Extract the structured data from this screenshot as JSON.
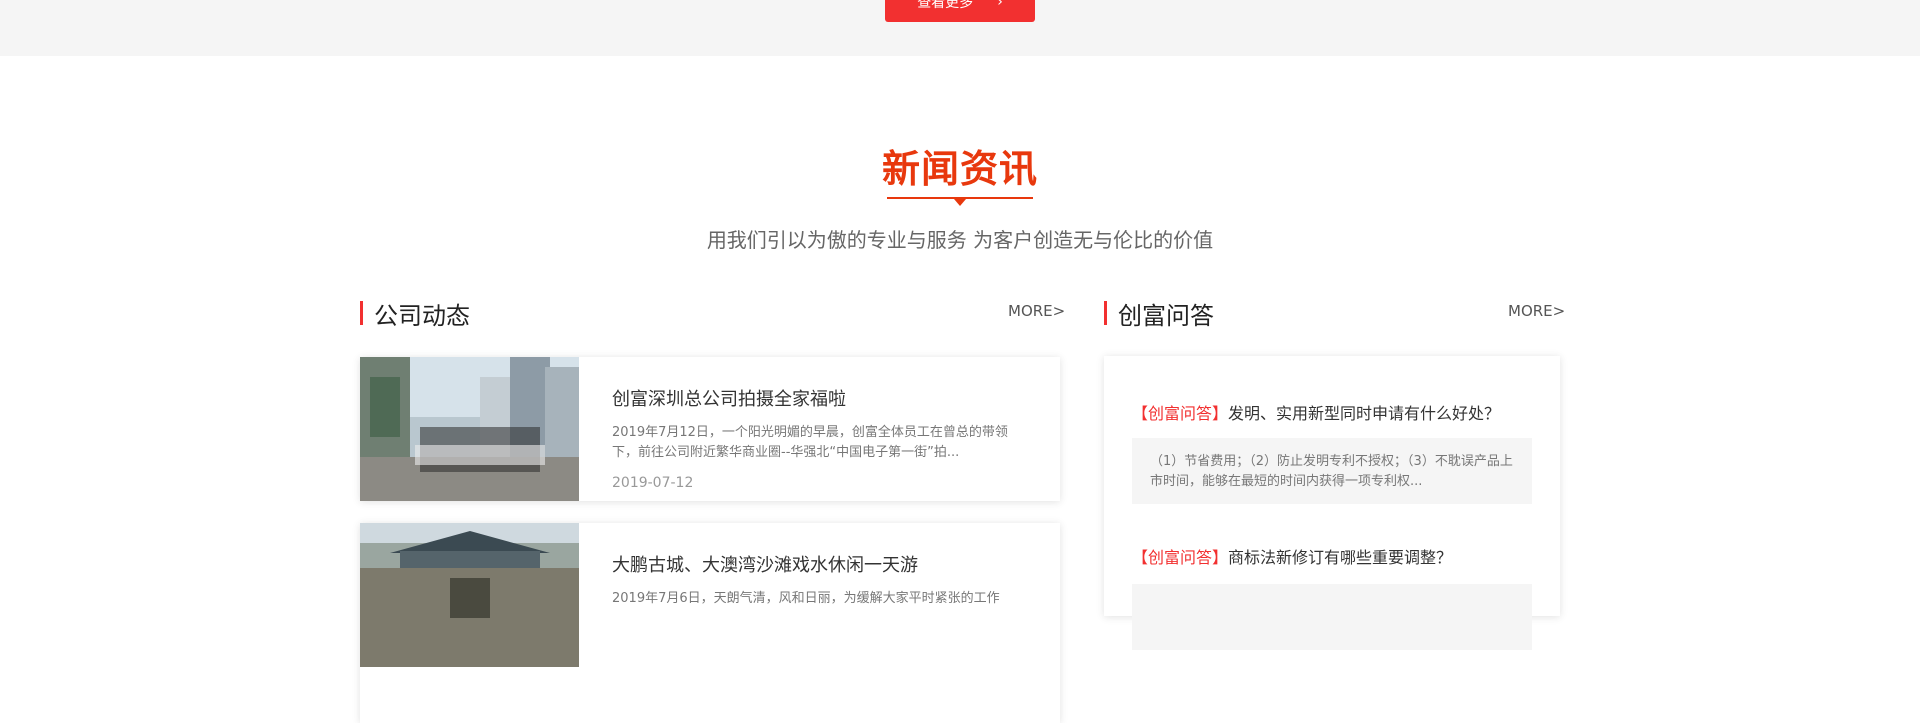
{
  "top": {
    "more_button": "查看更多"
  },
  "section": {
    "title": "新闻资讯",
    "subtitle": "用我们引以为傲的专业与服务 为客户创造无与伦比的价值"
  },
  "news": {
    "heading": "公司动态",
    "more": "MORE>",
    "items": [
      {
        "title": "创富深圳总公司拍摄全家福啦",
        "desc": "2019年7月12日，一个阳光明媚的早晨，创富全体员工在曾总的带领下，前往公司附近繁华商业圈--华强北“中国电子第一街”拍...",
        "date": "2019-07-12"
      },
      {
        "title": "大鹏古城、大澳湾沙滩戏水休闲一天游",
        "desc": "2019年7月6日，天朗气清，风和日丽，为缓解大家平时紧张的工作",
        "date": ""
      }
    ]
  },
  "qa": {
    "heading": "创富问答",
    "more": "MORE>",
    "items": [
      {
        "tag": "【创富问答】",
        "question": "发明、实用新型同时申请有什么好处？",
        "answer": "（1）节省费用；（2）防止发明专利不授权；（3）不耽误产品上市时间，能够在最短的时间内获得一项专利权..."
      },
      {
        "tag": "【创富问答】",
        "question": "商标法新修订有哪些重要调整？",
        "answer": ""
      }
    ]
  },
  "colors": {
    "accent": "#f23030",
    "title": "#e8380d"
  }
}
